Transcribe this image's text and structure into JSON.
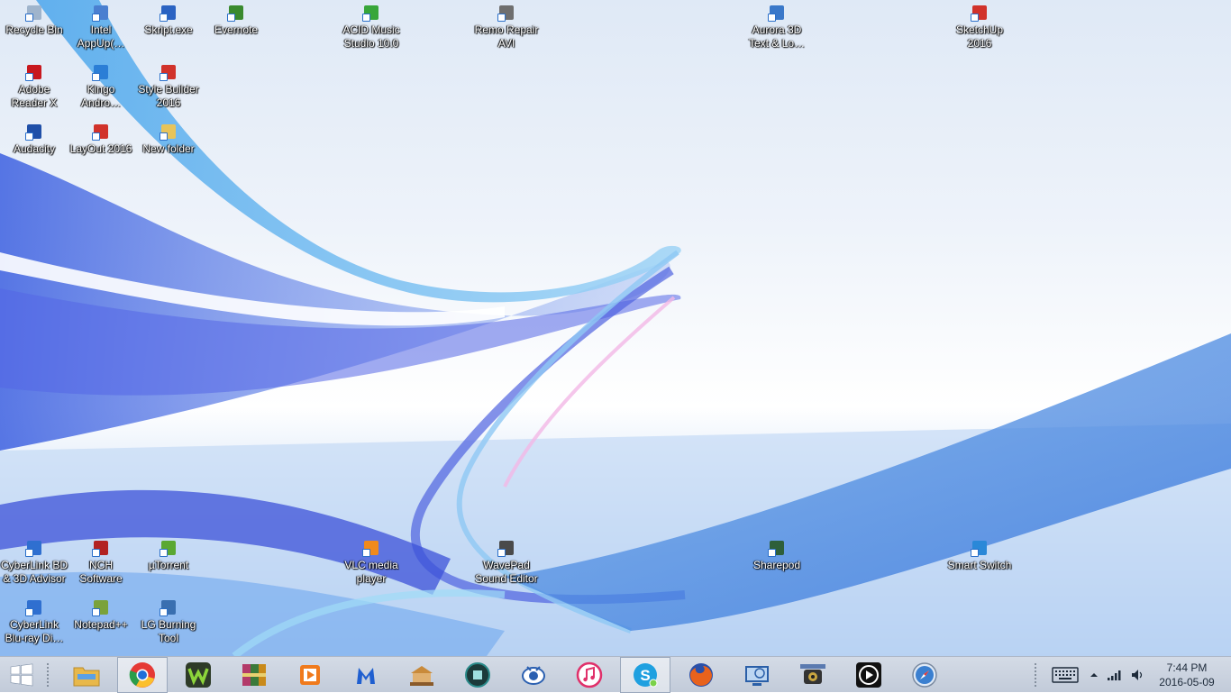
{
  "desktop": {
    "icons_top": [
      {
        "label": "Recycle Bin",
        "color": "#9fb4cc"
      },
      {
        "label": "Intel\nAppUp(…",
        "color": "#4a7fd0"
      },
      {
        "label": "Skript.exe",
        "color": "#2b63c2"
      },
      {
        "label": "Evernote",
        "color": "#3a8a2e"
      },
      {
        "label": "ACID Music\nStudio 10.0",
        "color": "#38a63a"
      },
      {
        "label": "Remo Repair\nAVI",
        "color": "#6f6f6f"
      },
      {
        "label": "Aurora 3D\nText & Lo…",
        "color": "#3a78c9"
      },
      {
        "label": "SketchUp\n2016",
        "color": "#d1322b"
      },
      {
        "label": "Adobe\nReader X",
        "color": "#c8181e"
      },
      {
        "label": "Kingo\nAndro…",
        "color": "#2b7ed6"
      },
      {
        "label": "Style Builder\n2016",
        "color": "#d1322b"
      },
      {
        "label": "Audacity",
        "color": "#1f4fa8"
      },
      {
        "label": "LayOut 2016",
        "color": "#d1322b"
      },
      {
        "label": "New folder",
        "color": "#e8c45a"
      }
    ],
    "icons_bottom": [
      {
        "label": "CyberLink BD\n& 3D Advisor",
        "color": "#2f6fd0"
      },
      {
        "label": "NCH\nSoftware",
        "color": "#b22222"
      },
      {
        "label": "µTorrent",
        "color": "#5aa832"
      },
      {
        "label": "VLC media\nplayer",
        "color": "#f08a1c"
      },
      {
        "label": "WavePad\nSound Editor",
        "color": "#4a4a4a"
      },
      {
        "label": "Sharepod",
        "color": "#2e5f3a"
      },
      {
        "label": "Smart Switch",
        "color": "#2a88d8"
      },
      {
        "label": "CyberLink\nBlu-ray Di…",
        "color": "#2f6fd0"
      },
      {
        "label": "Notepad++",
        "color": "#7aa23a"
      },
      {
        "label": "LG Burning\nTool",
        "color": "#3a6fb0"
      }
    ]
  },
  "taskbar": {
    "pinned": [
      {
        "name": "file-explorer",
        "color": "#e8b84a"
      },
      {
        "name": "chrome",
        "color": "#2a9d4a"
      },
      {
        "name": "wondershare",
        "color": "#6aa82e"
      },
      {
        "name": "winrar",
        "color": "#b33a6a"
      },
      {
        "name": "media-player",
        "color": "#f07a1c"
      },
      {
        "name": "malwarebytes",
        "color": "#1f5fd0"
      },
      {
        "name": "gallery-app",
        "color": "#c98a3a"
      },
      {
        "name": "video-editor",
        "color": "#2a8a8a"
      },
      {
        "name": "eye-app",
        "color": "#2a5fb0"
      },
      {
        "name": "itunes",
        "color": "#e0306a"
      },
      {
        "name": "skype",
        "color": "#1fa0e0"
      },
      {
        "name": "firefox",
        "color": "#e8621c"
      },
      {
        "name": "network-app",
        "color": "#2a5fa8"
      },
      {
        "name": "webcam",
        "color": "#333333"
      },
      {
        "name": "media-center",
        "color": "#111111"
      },
      {
        "name": "safari",
        "color": "#3a7fd0"
      }
    ],
    "clock": {
      "time": "7:44 PM",
      "date": "2016-05-09"
    }
  }
}
